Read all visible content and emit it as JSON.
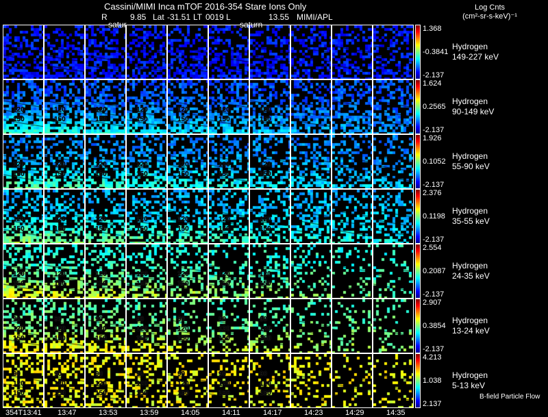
{
  "header": {
    "title": "Cassini/MIMI Inca mTOF  2016-354    Stare    Ions Only",
    "ephemeris": {
      "r_label": "R",
      "r_value": "9.85",
      "lat_label": "Lat",
      "lat_value": "-31.51",
      "lt_label": "LT",
      "lt_value": "0019",
      "l_label": "L",
      "l_value": "13.55",
      "source": "MIMI/APL"
    },
    "overlay_labels": [
      "satur",
      "saturn"
    ]
  },
  "colorbar_title": {
    "line1": "Log Cnts",
    "line2": "(cm²-sr-s-keV)⁻¹"
  },
  "chart_data": {
    "type": "heatmap",
    "colormap": "jet",
    "columns": [
      "354T13:41",
      "13:47",
      "13:53",
      "13:59",
      "14:05",
      "14:11",
      "14:17",
      "14:23",
      "14:29",
      "14:35"
    ],
    "contour_labels": [
      "90",
      "120",
      "150"
    ],
    "footer_note": "B-field Particle Flow",
    "rows": [
      {
        "species": "Hydrogen",
        "energy": "149-227 keV",
        "cbar_max": "1.368",
        "cbar_mid": "-0.3841",
        "cbar_min": "-2.137"
      },
      {
        "species": "Hydrogen",
        "energy": "90-149 keV",
        "cbar_max": "1.624",
        "cbar_mid": "0.2565",
        "cbar_min": "-2.137"
      },
      {
        "species": "Hydrogen",
        "energy": "55-90 keV",
        "cbar_max": "1.926",
        "cbar_mid": "0.1052",
        "cbar_min": "-2.137"
      },
      {
        "species": "Hydrogen",
        "energy": "35-55 keV",
        "cbar_max": "2.376",
        "cbar_mid": "0.1198",
        "cbar_min": "-2.137"
      },
      {
        "species": "Hydrogen",
        "energy": "24-35 keV",
        "cbar_max": "2.554",
        "cbar_mid": "0.2087",
        "cbar_min": "-2.137"
      },
      {
        "species": "Hydrogen",
        "energy": "13-24 keV",
        "cbar_max": "2.907",
        "cbar_mid": "0.3854",
        "cbar_min": "-2.137"
      },
      {
        "species": "Hydrogen",
        "energy": "5-13 keV",
        "cbar_max": "4.213",
        "cbar_mid": "1.038",
        "cbar_min": "2.137"
      }
    ]
  }
}
